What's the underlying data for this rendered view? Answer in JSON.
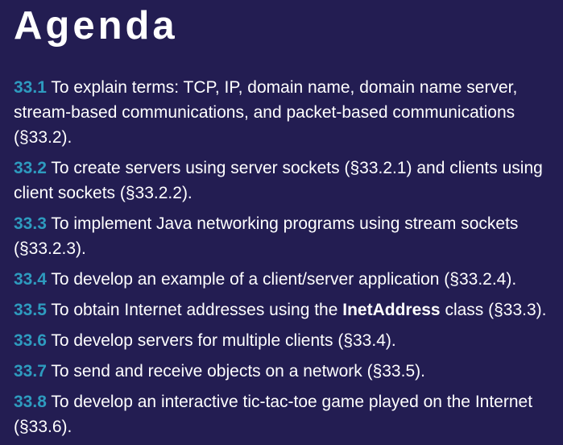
{
  "slide": {
    "title": "Agenda"
  },
  "colors": {
    "background": "#231d52",
    "text": "#ffffff",
    "section_number": "#2e9bbf"
  },
  "items": [
    {
      "number": "33.1",
      "text": "To explain terms: TCP, IP, domain name, domain name server, stream-based communications, and packet-based communications (§33.2)."
    },
    {
      "number": "33.2",
      "text": "To create servers using server sockets (§33.2.1) and clients using client sockets (§33.2.2)."
    },
    {
      "number": "33.3",
      "text": "To implement Java networking programs using stream sockets (§33.2.3)."
    },
    {
      "number": "33.4",
      "text": "To develop an example of a client/server application (§33.2.4)."
    },
    {
      "number": "33.5",
      "text_before": "To obtain Internet addresses using the ",
      "bold": "InetAddress",
      "text_after": " class (§33.3)."
    },
    {
      "number": "33.6",
      "text": "To develop servers for multiple clients (§33.4)."
    },
    {
      "number": "33.7",
      "text": "To send and receive objects on a network (§33.5)."
    },
    {
      "number": "33.8",
      "text": "To develop an interactive tic-tac-toe game played on the Internet (§33.6)."
    }
  ]
}
